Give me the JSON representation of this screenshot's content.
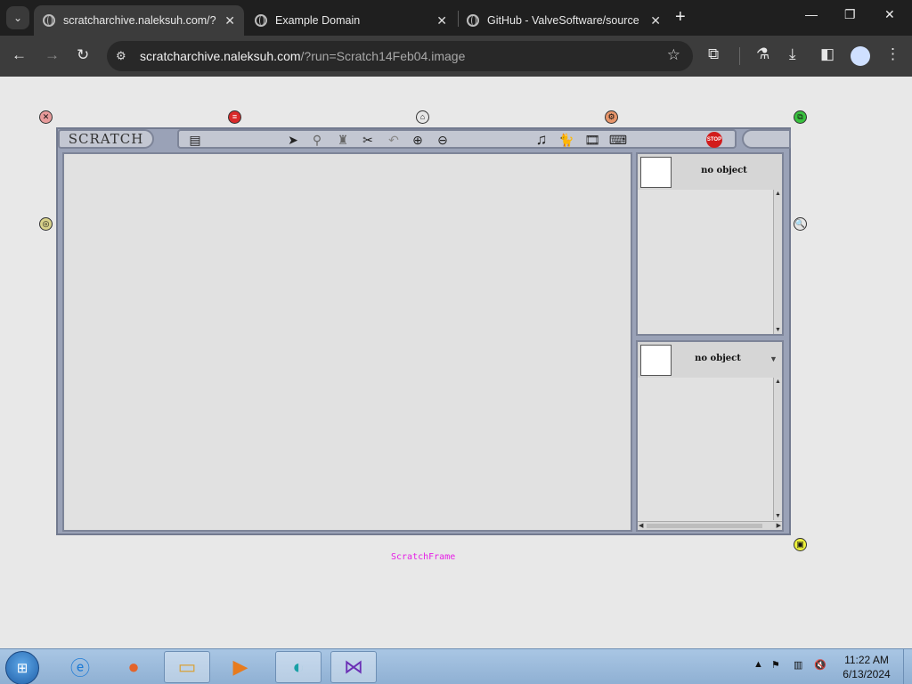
{
  "browser": {
    "tabs": [
      {
        "title": "scratcharchive.naleksuh.com/?",
        "active": true
      },
      {
        "title": "Example Domain",
        "active": false
      },
      {
        "title": "GitHub - ValveSoftware/source",
        "active": false
      }
    ],
    "url_host": "scratcharchive.naleksuh.com",
    "url_path": "/?run=Scratch14Feb04.image",
    "icons": {
      "tab_search": "chevron-down-icon",
      "close_tab": "close-icon",
      "new_tab": "plus-icon",
      "back": "arrow-left-icon",
      "forward": "arrow-right-icon",
      "reload": "reload-icon",
      "site_info": "tune-icon",
      "bookmark": "star-icon",
      "extensions": "puzzle-icon",
      "labs": "flask-icon",
      "downloads": "download-icon",
      "side_panel": "sidepanel-icon",
      "profile": "account-icon",
      "menu": "kebab-icon",
      "minimize": "minimize-icon",
      "restore": "restore-icon",
      "close_window": "close-window-icon"
    }
  },
  "scratch": {
    "logo_text": "SCRATCH",
    "top_panel_label": "no object",
    "bottom_panel_label": "no object",
    "stop_label": "STOP",
    "frame_caption": "ScratchFrame",
    "tools": [
      "stage-icon",
      "arrow-cursor-icon",
      "magnify-icon",
      "stamp-icon",
      "scissors-icon",
      "undo-icon",
      "zoom-in-icon",
      "zoom-out-icon",
      "music-note-icon",
      "cat-icon",
      "film-icon",
      "keyboard-icon",
      "stop-sign-icon"
    ],
    "handle_colors": {
      "close": "#e79b9b",
      "menu": "#d92a2a",
      "collapse": "#e6e6e6",
      "debug": "#e7956a",
      "duplicate": "#39c13f",
      "rotate": "#d8d28a",
      "inspect": "#e6e6e6",
      "resize": "#eef23c"
    }
  },
  "taskbar": {
    "time": "11:22 AM",
    "date": "6/13/2024",
    "apps": [
      "internet-explorer-icon",
      "firefox-icon",
      "file-explorer-icon",
      "media-player-icon",
      "app-icon",
      "visual-studio-icon"
    ]
  }
}
